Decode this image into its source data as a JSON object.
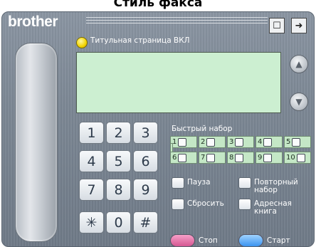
{
  "page_title": "Стиль факса",
  "panel": {
    "brand": "brother",
    "cover_page_label": "Титульная страница ВКЛ",
    "keypad": {
      "keys": [
        "1",
        "2",
        "3",
        "4",
        "5",
        "6",
        "7",
        "8",
        "9",
        "✳",
        "0",
        "#"
      ]
    },
    "speed_dial": {
      "title": "Быстрый набор",
      "slots": [
        "1",
        "2",
        "3",
        "4",
        "5",
        "6",
        "7",
        "8",
        "9",
        "10"
      ]
    },
    "functions": {
      "pause": "Пауза",
      "redial": "Повторный набор",
      "reset": "Сбросить",
      "address_book": "Адресная книга"
    },
    "stop_label": "Стоп",
    "start_label": "Старт"
  },
  "icons": {
    "top_left": "document-icon",
    "top_right": "send-icon"
  },
  "colors": {
    "panel": "#7c8794",
    "display": "#ccefd1",
    "stop": "#e46aa5",
    "start": "#4aa8ff"
  }
}
